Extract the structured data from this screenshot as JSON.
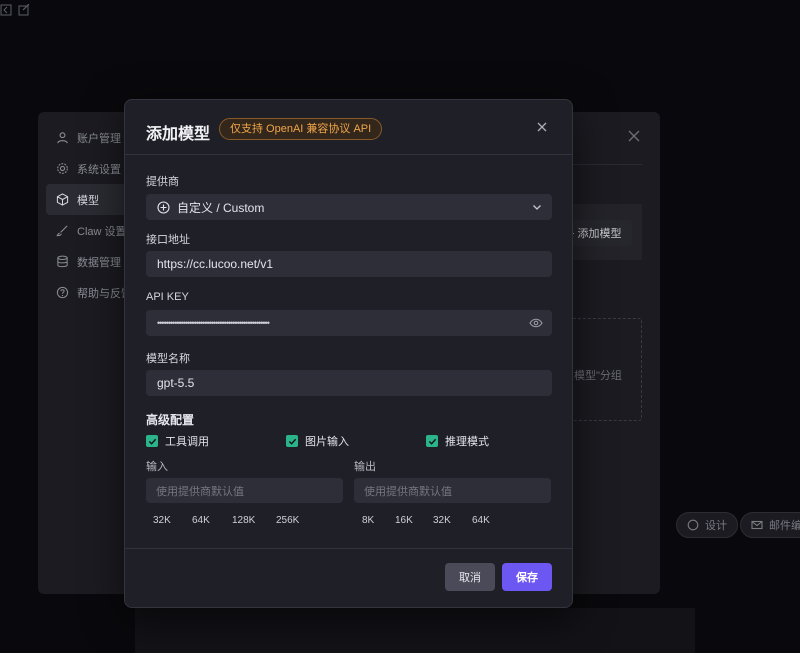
{
  "background": {
    "sidebar": {
      "items": [
        {
          "label": "账户管理",
          "icon": "user-icon"
        },
        {
          "label": "系统设置",
          "icon": "gear-icon"
        },
        {
          "label": "模型",
          "icon": "cube-icon",
          "active": true
        },
        {
          "label": "Claw 设置",
          "icon": "brush-icon"
        },
        {
          "label": "数据管理",
          "icon": "database-icon"
        },
        {
          "label": "帮助与反馈",
          "icon": "help-icon"
        }
      ]
    },
    "add_model_label": "+ 添加模型",
    "dashed_hint": "模型\"分组",
    "chips": [
      {
        "label": "设计",
        "icon": "chat-icon"
      },
      {
        "label": "邮件编",
        "icon": "mail-icon"
      }
    ]
  },
  "modal": {
    "title": "添加模型",
    "badge": "仅支持 OpenAI 兼容协议 API",
    "provider": {
      "label": "提供商",
      "value": "自定义 / Custom"
    },
    "endpoint": {
      "label": "接口地址",
      "value": "https://cc.lucoo.net/v1"
    },
    "api_key": {
      "label": "API KEY",
      "masked_value": "••••••••••••••••••••••••••••••••••••••••••••••••••••"
    },
    "model_name": {
      "label": "模型名称",
      "value": "gpt-5.5"
    },
    "advanced": {
      "title": "高级配置",
      "options": [
        {
          "label": "工具调用",
          "checked": true
        },
        {
          "label": "图片输入",
          "checked": true
        },
        {
          "label": "推理模式",
          "checked": true
        }
      ],
      "input": {
        "label": "输入",
        "placeholder": "使用提供商默认值",
        "presets": [
          "32K",
          "64K",
          "128K",
          "256K"
        ]
      },
      "output": {
        "label": "输出",
        "placeholder": "使用提供商默认值",
        "presets": [
          "8K",
          "16K",
          "32K",
          "64K"
        ]
      }
    },
    "buttons": {
      "cancel": "取消",
      "save": "保存"
    }
  },
  "colors": {
    "accent": "#6d57f2",
    "check": "#2bb38a",
    "badge": "#f0a64a"
  }
}
